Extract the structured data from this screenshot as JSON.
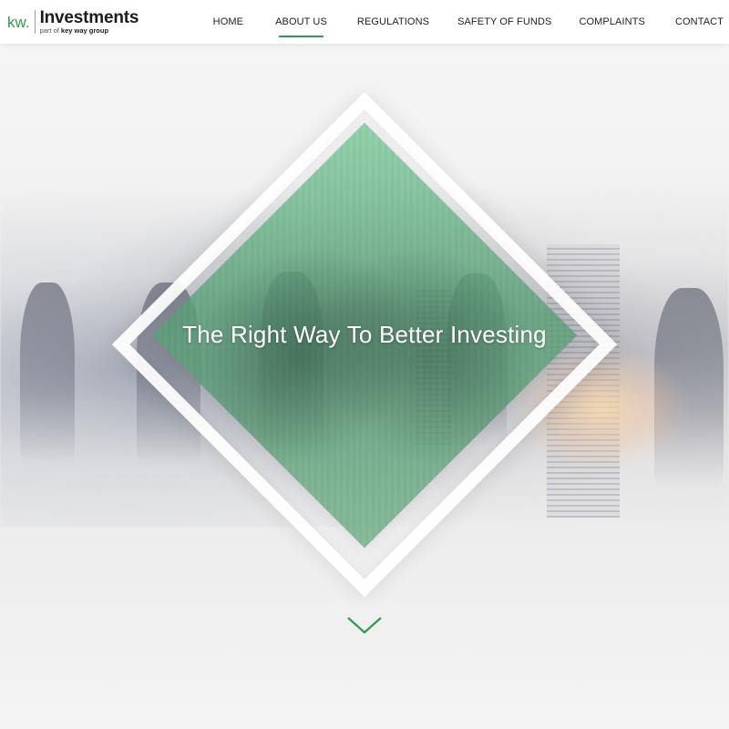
{
  "brand": {
    "mark": "kw.",
    "title": "Investments",
    "subtitle_prefix": "part of ",
    "subtitle_group": "key way group",
    "accent_color": "#2f9a4b"
  },
  "nav": {
    "items": [
      {
        "label": "HOME",
        "active": false
      },
      {
        "label": "ABOUT US",
        "active": true
      },
      {
        "label": "REGULATIONS",
        "active": false
      },
      {
        "label": "SAFETY OF FUNDS",
        "active": false
      },
      {
        "label": "COMPLAINTS",
        "active": false
      },
      {
        "label": "CONTACT",
        "active": false
      }
    ]
  },
  "hero": {
    "headline": "The Right Way To Better Investing",
    "scroll_icon": "chevron-down-icon"
  }
}
